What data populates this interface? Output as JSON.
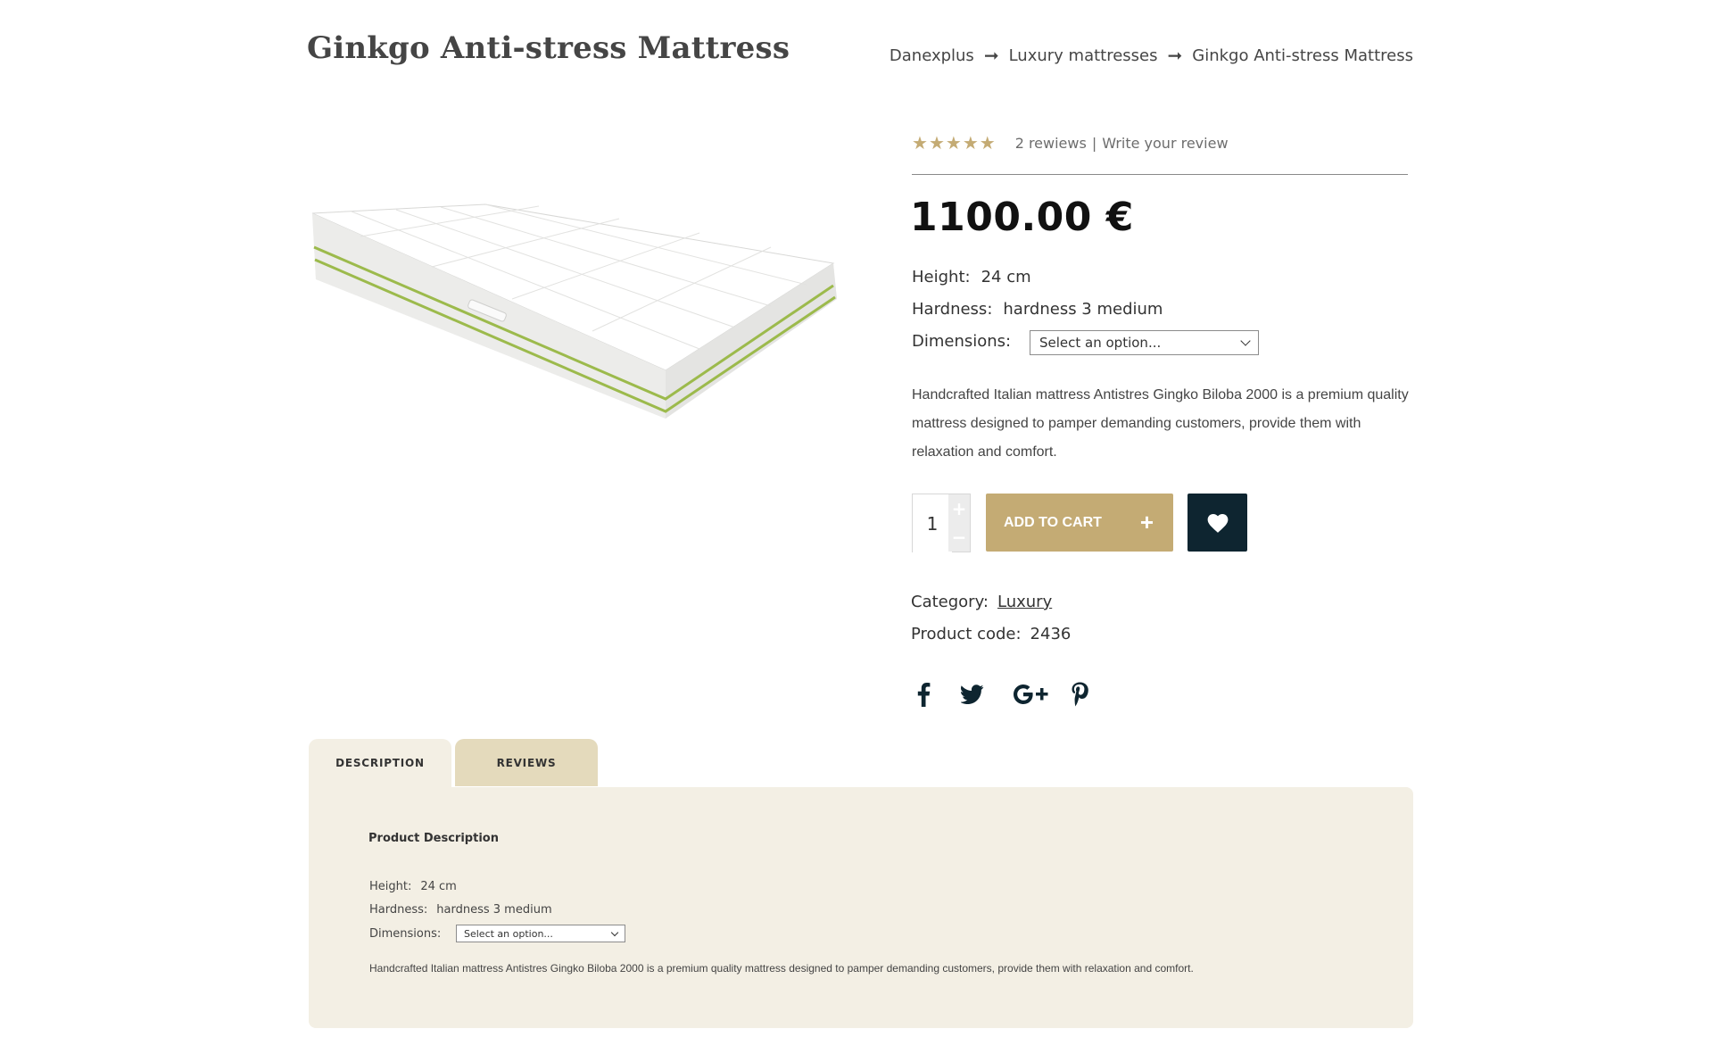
{
  "header": {
    "title": "Ginkgo Anti-stress Mattress",
    "breadcrumb": [
      "Danexplus",
      "Luxury mattresses",
      "Ginkgo Anti-stress Mattress"
    ],
    "separator": "➞"
  },
  "product": {
    "rating": {
      "stars_filled": 5,
      "stars_total": 5,
      "reviews_text": "2 rewiews",
      "separator": "|",
      "write_text": "Write your review"
    },
    "price": "1100.00 €",
    "attributes": {
      "height_label": "Height:",
      "height_value": "24 cm",
      "hardness_label": "Hardness:",
      "hardness_value": "hardness 3 medium",
      "dimensions_label": "Dimensions:",
      "dimensions_placeholder": "Select an option..."
    },
    "description": "Handcrafted Italian mattress Antistres Gingko Biloba 2000 is a premium quality mattress designed to pamper demanding customers, provide them with relaxation and comfort.",
    "quantity": "1",
    "add_to_cart_label": "ADD TO CART",
    "category_label": "Category:",
    "category_value": "Luxury",
    "code_label": "Product code:",
    "code_value": "2436",
    "image_icon": "mattress-image"
  },
  "social": [
    "facebook-icon",
    "twitter-icon",
    "google-plus-icon",
    "pinterest-icon"
  ],
  "tabs": [
    {
      "label": "DESCRIPTION",
      "active": true
    },
    {
      "label": "REVIEWS",
      "active": false
    }
  ],
  "panel": {
    "title": "Product Description",
    "height_label": "Height:",
    "height_value": "24 cm",
    "hardness_label": "Hardness:",
    "hardness_value": "hardness 3 medium",
    "dimensions_label": "Dimensions:",
    "dimensions_placeholder": "Select an option...",
    "description": "Handcrafted Italian mattress Antistres Gingko Biloba 2000 is a premium quality mattress designed to pamper demanding customers, provide them with relaxation and comfort."
  },
  "colors": {
    "accent": "#c4ab74",
    "dark": "#0e2530",
    "panel_bg": "#f3efe4",
    "tab_inactive": "#e4dabc"
  }
}
